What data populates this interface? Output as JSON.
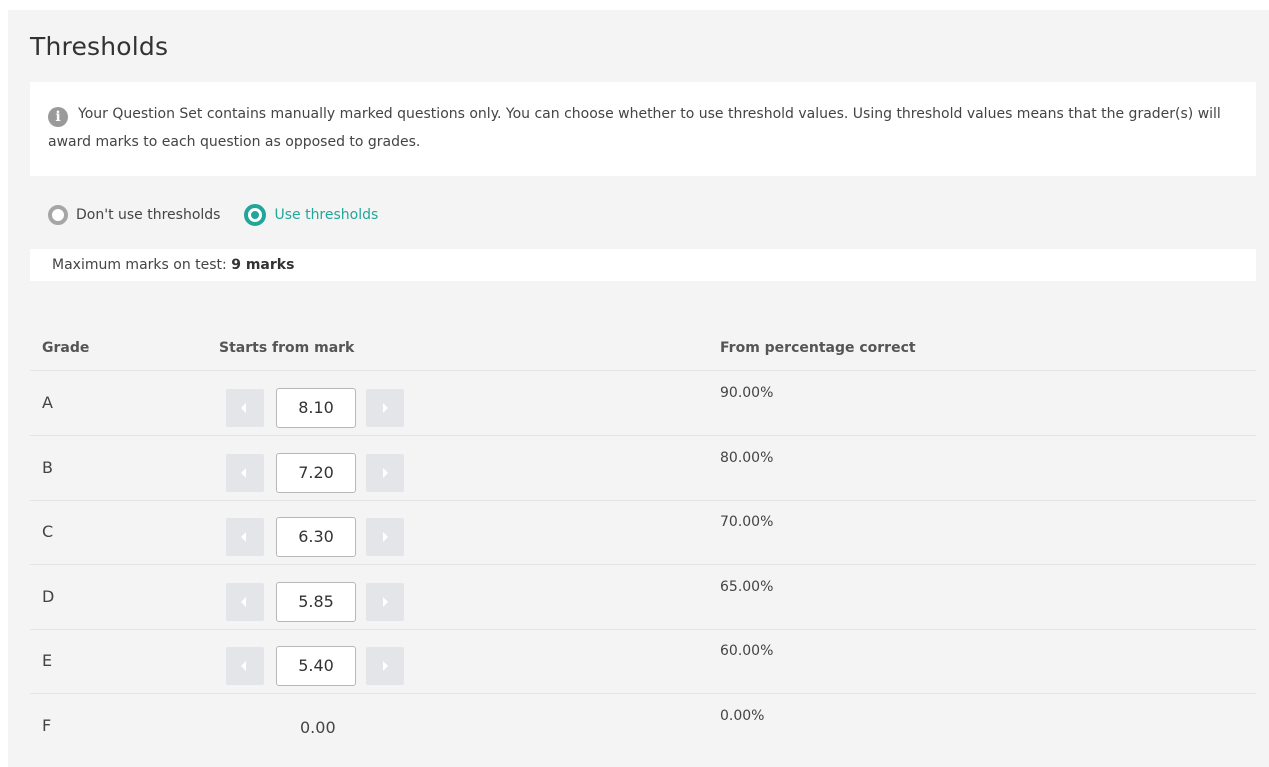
{
  "title": "Thresholds",
  "info": {
    "icon": "info-icon",
    "text": "Your Question Set contains manually marked questions only. You can choose whether to use threshold values. Using threshold values means that the grader(s) will award marks to each question as opposed to grades."
  },
  "threshold_options": [
    {
      "label": "Don't use thresholds",
      "selected": false
    },
    {
      "label": "Use thresholds",
      "selected": true
    }
  ],
  "max_marks": {
    "label": "Maximum marks on test:",
    "value": "9 marks"
  },
  "table": {
    "headers": [
      "Grade",
      "Starts from mark",
      "From percentage correct"
    ],
    "rows": [
      {
        "grade": "A",
        "mark": "8.10",
        "percent": "90.00%",
        "editable": true
      },
      {
        "grade": "B",
        "mark": "7.20",
        "percent": "80.00%",
        "editable": true
      },
      {
        "grade": "C",
        "mark": "6.30",
        "percent": "70.00%",
        "editable": true
      },
      {
        "grade": "D",
        "mark": "5.85",
        "percent": "65.00%",
        "editable": true
      },
      {
        "grade": "E",
        "mark": "5.40",
        "percent": "60.00%",
        "editable": true
      },
      {
        "grade": "F",
        "mark": "0.00",
        "percent": "0.00%",
        "editable": false
      }
    ]
  },
  "colors": {
    "accent": "#22a699",
    "panel_bg": "#f4f4f4",
    "stepper_bg": "#e3e5e8"
  }
}
